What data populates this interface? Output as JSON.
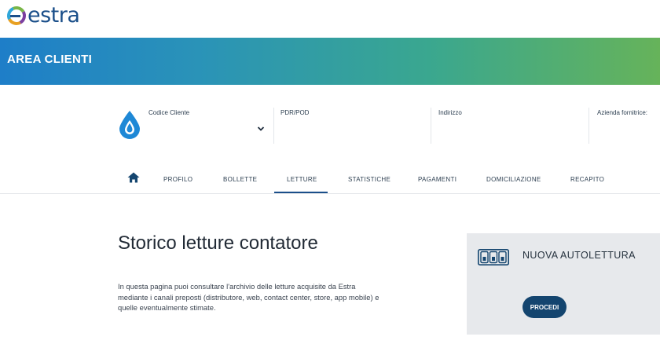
{
  "brand": {
    "name": "estra"
  },
  "banner": {
    "title": "AREA CLIENTI"
  },
  "customer_fields": [
    {
      "label": "Codice Cliente",
      "value": ""
    },
    {
      "label": "PDR/POD",
      "value": ""
    },
    {
      "label": "Indirizzo",
      "value": ""
    },
    {
      "label": "Azienda fornitrice:",
      "value": ""
    }
  ],
  "nav": {
    "items": [
      "PROFILO",
      "BOLLETTE",
      "LETTURE",
      "STATISTICHE",
      "PAGAMENTI",
      "DOMICILIAZIONE",
      "RECAPITO"
    ],
    "active": "LETTURE"
  },
  "main": {
    "title": "Storico letture contatore",
    "description": "In questa pagina puoi consultare l'archivio delle letture acquisite da Estra mediante i canali preposti (distributore, web, contact center, store, app mobile) e quelle eventualmente stimate."
  },
  "card": {
    "title": "NUOVA AUTOLETTURA",
    "button_label": "PROCEDI"
  },
  "colors": {
    "banner_gradient_start": "#1e7ec8",
    "banner_gradient_end": "#66b35a",
    "primary": "#14456f",
    "drop_icon": "#1e88d6"
  },
  "icons": [
    "estra-logo-icon",
    "water-drop-icon",
    "chevron-down-icon",
    "home-icon",
    "meter-icon"
  ]
}
